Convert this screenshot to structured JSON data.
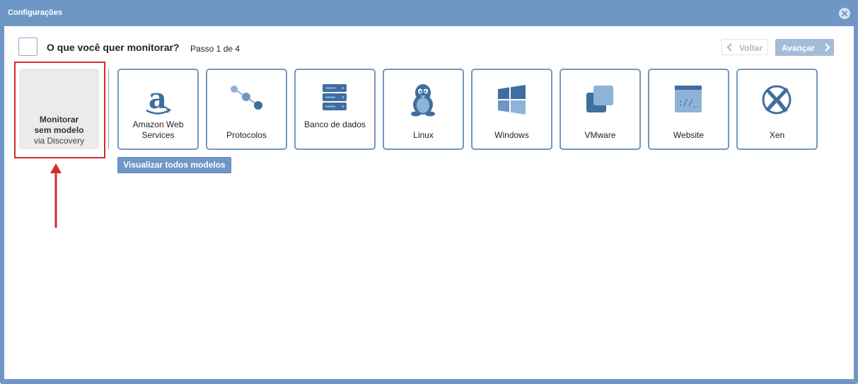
{
  "window": {
    "title": "Configurações",
    "close_icon": "close-icon"
  },
  "header": {
    "question": "O que você quer monitorar?",
    "step": "Passo 1 de 4",
    "back_label": "Voltar",
    "next_label": "Avançar"
  },
  "discovery": {
    "line1": "Monitorar",
    "line2": "sem modelo",
    "line3": "via Discovery"
  },
  "templates": [
    {
      "label": "Amazon Web Services",
      "icon": "amazon-icon"
    },
    {
      "label": "Protocolos",
      "icon": "protocols-icon"
    },
    {
      "label": "Banco de dados",
      "icon": "database-icon"
    },
    {
      "label": "Linux",
      "icon": "linux-icon"
    },
    {
      "label": "Windows",
      "icon": "windows-icon"
    },
    {
      "label": "VMware",
      "icon": "vmware-icon"
    },
    {
      "label": "Website",
      "icon": "website-icon"
    },
    {
      "label": "Xen",
      "icon": "xen-icon"
    }
  ],
  "view_all_label": "Visualizar todos modelos",
  "colors": {
    "titlebar": "#6f97c6",
    "icon_dark": "#3f6e9f",
    "icon_light": "#8fb2d9",
    "highlight_red": "#d62b2b"
  }
}
